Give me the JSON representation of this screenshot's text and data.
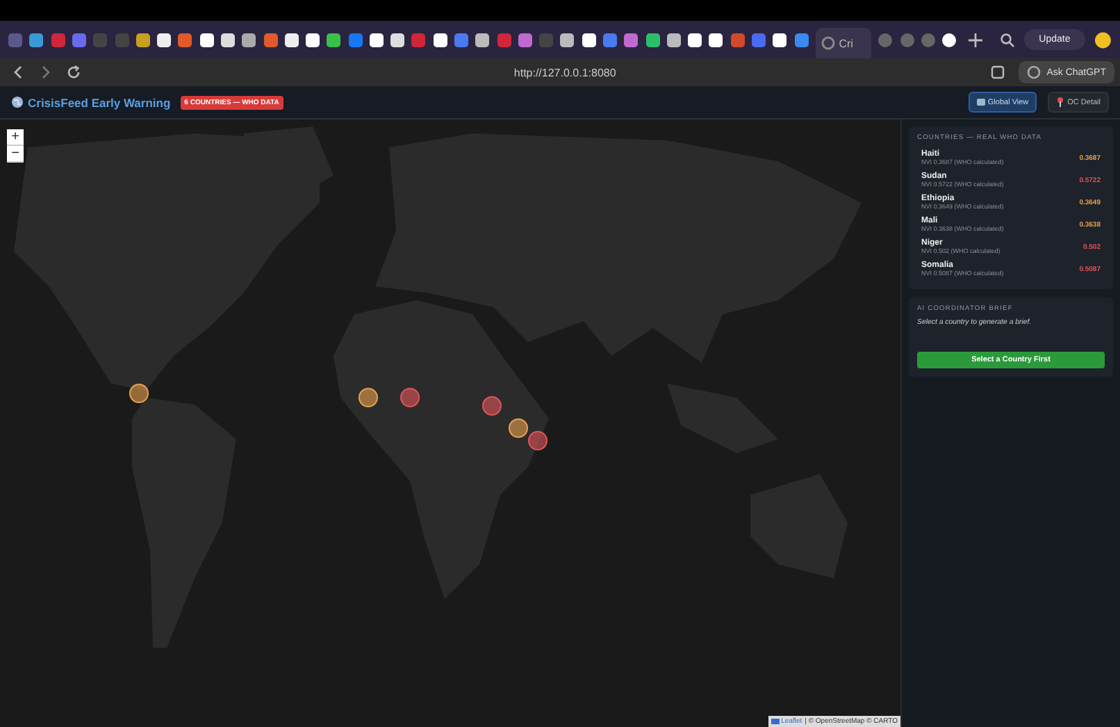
{
  "browser": {
    "active_tab": {
      "title": "Cri",
      "selected": true
    },
    "update_button": "Update",
    "url": "http://127.0.0.1:8080",
    "ask_button": "Ask ChatGPT"
  },
  "app": {
    "title": "CrisisFeed Early Warning",
    "badge": "6 COUNTRIES — WHO DATA",
    "buttons": [
      {
        "label": "Global View",
        "selected": true
      },
      {
        "label": "OC Detail",
        "selected": false
      }
    ]
  },
  "map": {
    "zoom_in": "+",
    "zoom_out": "−",
    "attribution_link": "Leaflet",
    "attribution": "| © OpenStreetMap © CARTO"
  },
  "countries_panel": {
    "heading": "COUNTRIES — REAL WHO DATA",
    "countries": [
      {
        "name": "Haiti",
        "detail": "NVI 0.3687 (WHO calculated)",
        "score": "0.3687",
        "color": "#e8a04e"
      },
      {
        "name": "Sudan",
        "detail": "NVI 0.5722 (WHO calculated)",
        "score": "0.5722",
        "color": "#e0555a"
      },
      {
        "name": "Ethiopia",
        "detail": "NVI 0.3649 (WHO calculated)",
        "score": "0.3649",
        "color": "#e8a04e"
      },
      {
        "name": "Mali",
        "detail": "NVI 0.3638 (WHO calculated)",
        "score": "0.3638",
        "color": "#e8a04e"
      },
      {
        "name": "Niger",
        "detail": "NVI 0.502 (WHO calculated)",
        "score": "0.502",
        "color": "#e0555a"
      },
      {
        "name": "Somalia",
        "detail": "NVI 0.5087 (WHO calculated)",
        "score": "0.5087",
        "color": "#e0555a"
      }
    ]
  },
  "brief_panel": {
    "heading": "AI COORDINATOR BRIEF",
    "text": "Select a country to generate a brief.",
    "button": "Select a Country First"
  }
}
